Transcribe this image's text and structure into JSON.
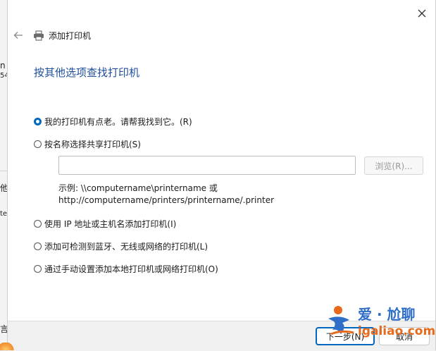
{
  "window": {
    "title": "添加打印机"
  },
  "heading": "按其他选项查找打印机",
  "options": [
    {
      "label": "我的打印机有点老。请帮我找到它。(R)",
      "checked": true
    },
    {
      "label": "按名称选择共享打印机(S)",
      "checked": false
    },
    {
      "label": "使用 IP 地址或主机名添加打印机(I)",
      "checked": false
    },
    {
      "label": "添加可检测到蓝牙、无线或网络的打印机(L)",
      "checked": false
    },
    {
      "label": "通过手动设置添加本地打印机或网络打印机(O)",
      "checked": false
    }
  ],
  "share": {
    "value": "",
    "browse_label": "浏览(R)...",
    "example_line1": "示例: \\\\computername\\printername 或",
    "example_line2": "http://computername/printers/printername/.printer"
  },
  "footer": {
    "next_label": "下一步(N)",
    "cancel_label": "取消"
  },
  "watermark": {
    "top": "爱 · 尬聊",
    "bottom": "igaliao.com"
  },
  "background": {
    "frag1": "n",
    "frag2": "54",
    "frag3": "他",
    "frag4": "te",
    "frag5": "言"
  },
  "colors": {
    "accent": "#0067c0",
    "heading": "#1f4e9c"
  },
  "icons": [
    "close-icon",
    "back-arrow-icon",
    "printer-icon"
  ]
}
